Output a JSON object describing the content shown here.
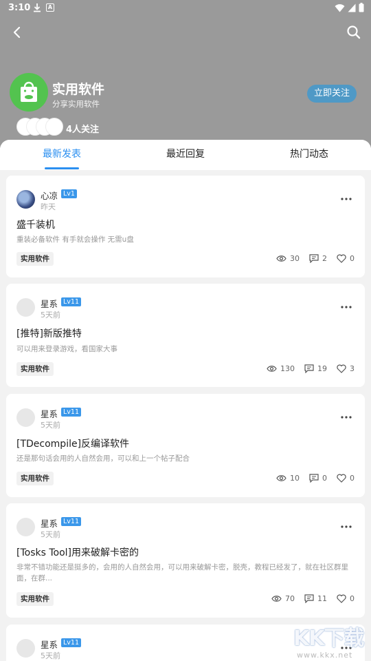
{
  "status_bar": {
    "time": "3:10",
    "letter": "A"
  },
  "group": {
    "name": "实用软件",
    "description": "分享实用软件",
    "follow_button": "立即关注",
    "followers_label": "4人关注"
  },
  "tabs": [
    "最新发表",
    "最近回复",
    "热门动态"
  ],
  "posts": [
    {
      "author": "心凉",
      "level": "Lv1",
      "time": "昨天",
      "title": "盛千装机",
      "summary": "重装必备软件 有手就会操作 无需u盘",
      "tag": "实用软件",
      "views": "30",
      "comments": "2",
      "likes": "0"
    },
    {
      "author": "星系",
      "level": "Lv11",
      "time": "5天前",
      "title": "[推特]新版推特",
      "summary": "可以用来登录游戏，看国家大事",
      "tag": "实用软件",
      "views": "130",
      "comments": "19",
      "likes": "3"
    },
    {
      "author": "星系",
      "level": "Lv11",
      "time": "5天前",
      "title": "[TDecompile]反编译软件",
      "summary": "还是那句话会用的人自然会用，可以和上一个帖子配合",
      "tag": "实用软件",
      "views": "10",
      "comments": "0",
      "likes": "0"
    },
    {
      "author": "星系",
      "level": "Lv11",
      "time": "5天前",
      "title": "[Tosks Tool]用来破解卡密的",
      "summary": "非常不错功能还是挺多的，会用的人自然会用，可以用来破解卡密，脱壳，教程已经发了，就在社区群里面，在群...",
      "tag": "实用软件",
      "views": "70",
      "comments": "11",
      "likes": "0"
    },
    {
      "author": "星系",
      "level": "Lv11",
      "time": "5天前"
    }
  ],
  "watermark": {
    "brand": "KK下载",
    "url": "www.kkx.net"
  },
  "colors": {
    "accent": "#2b8ff0",
    "level_badge": "#3a97ea",
    "follow_button": "#4f99c6",
    "logo": "#53c34f"
  }
}
